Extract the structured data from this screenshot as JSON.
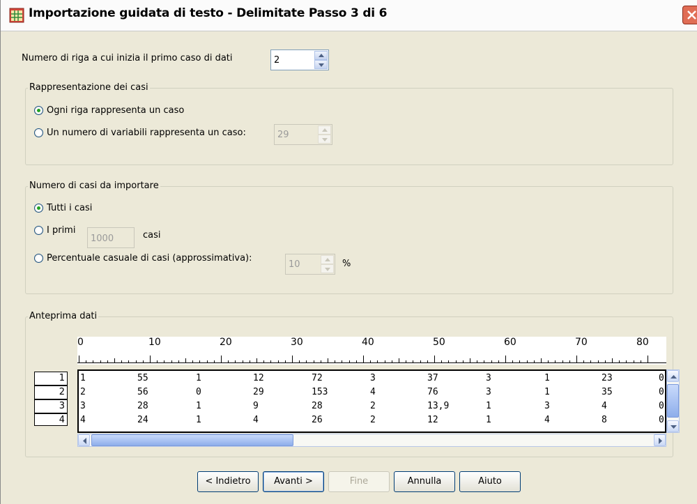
{
  "window": {
    "title": "Importazione guidata di testo - Delimitate Passo 3 di 6"
  },
  "first_case_row": {
    "label": "Numero di riga a cui inizia il primo caso di dati",
    "value": "2"
  },
  "case_representation": {
    "title": "Rappresentazione dei casi",
    "option_each_line": "Ogni riga rappresenta un caso",
    "option_num_vars": "Un numero di variabili rappresenta un caso:",
    "num_vars_value": "29",
    "selected": "option_each_line"
  },
  "cases_to_import": {
    "title": "Numero di casi da importare",
    "option_all": "Tutti i casi",
    "option_first": "I primi",
    "first_value": "1000",
    "first_suffix": "casi",
    "option_percent": "Percentuale casuale di casi (approssimativa):",
    "percent_value": "10",
    "percent_suffix": "%",
    "selected": "option_all"
  },
  "preview": {
    "title": "Anteprima dati",
    "ruler_labels": [
      "0",
      "10",
      "20",
      "30",
      "40",
      "50",
      "60",
      "70",
      "80"
    ],
    "row_numbers": [
      "1",
      "2",
      "3",
      "4"
    ],
    "rows": [
      [
        "1",
        "55",
        "1",
        "12",
        "72",
        "3",
        "37",
        "3",
        "1",
        "23",
        "0"
      ],
      [
        "2",
        "56",
        "0",
        "29",
        "153",
        "4",
        "76",
        "3",
        "1",
        "35",
        "0"
      ],
      [
        "3",
        "28",
        "1",
        "9",
        "28",
        "2",
        "13,9",
        "1",
        "3",
        "4",
        "0"
      ],
      [
        "4",
        "24",
        "1",
        "4",
        "26",
        "2",
        "12",
        "1",
        "4",
        "8",
        "0"
      ]
    ]
  },
  "buttons": {
    "back": "< Indietro",
    "next": "Avanti >",
    "finish": "Fine",
    "cancel": "Annulla",
    "help": "Aiuto"
  }
}
